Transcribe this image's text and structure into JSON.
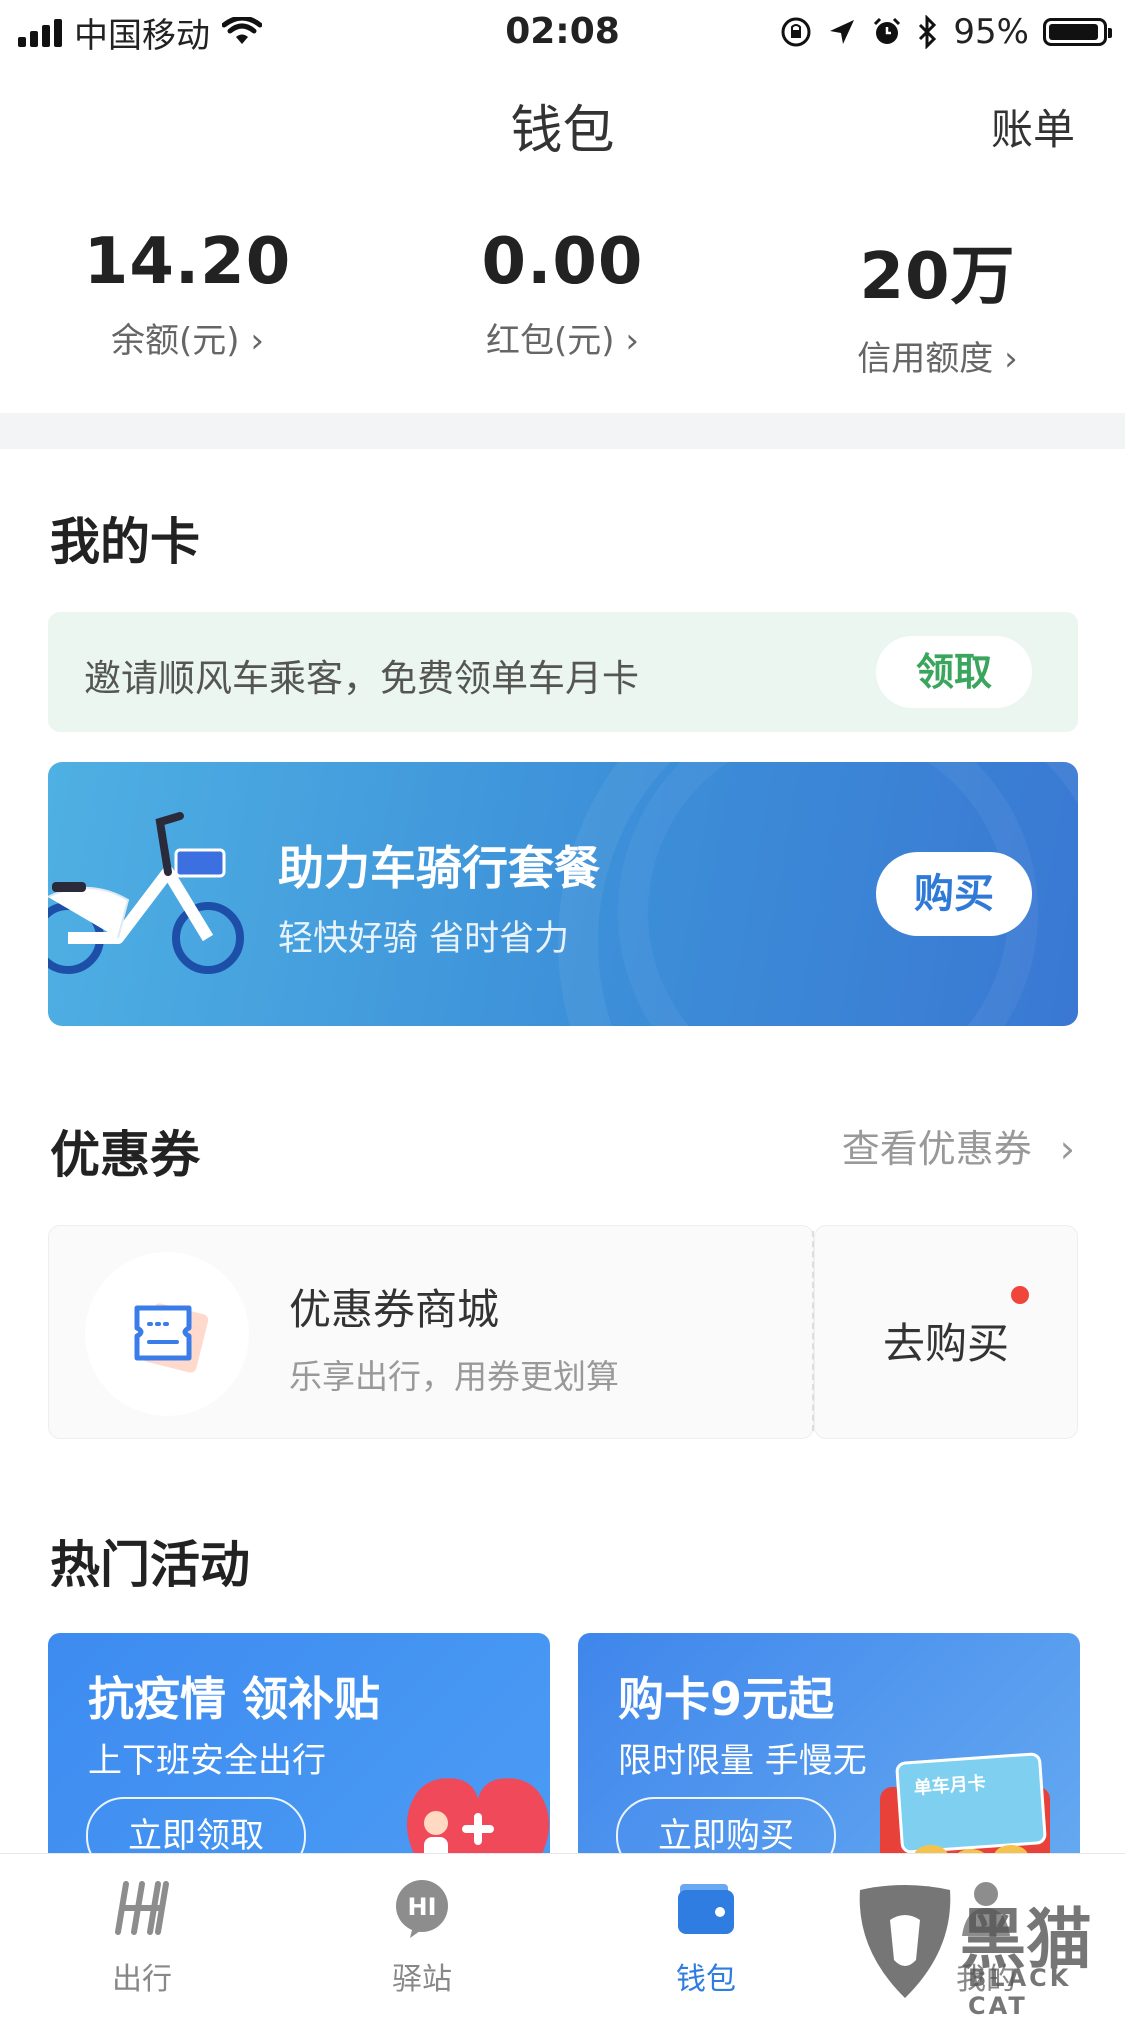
{
  "status_bar": {
    "carrier": "中国移动",
    "time": "02:08",
    "battery": "95%",
    "battery_level": 0.95
  },
  "nav": {
    "title": "钱包",
    "right": "账单"
  },
  "balances": [
    {
      "value": "14.20",
      "label": "余额(元)",
      "arrow": "›"
    },
    {
      "value": "0.00",
      "label": "红包(元)",
      "arrow": "›"
    },
    {
      "value": "20万",
      "label": "信用额度",
      "arrow": "›"
    }
  ],
  "my_cards": {
    "title": "我的卡",
    "invite": {
      "text": "邀请顺风车乘客，免费领单车月卡",
      "button": "领取"
    },
    "ebike": {
      "title": "助力车骑行套餐",
      "subtitle": "轻快好骑 省时省力",
      "button": "购买"
    }
  },
  "coupons": {
    "title": "优惠券",
    "link": "查看优惠券",
    "link_arrow": "›",
    "card": {
      "title": "优惠券商城",
      "subtitle": "乐享出行，用券更划算",
      "button": "去购买"
    }
  },
  "hot": {
    "title": "热门活动",
    "promos": [
      {
        "title": "抗疫情 领补贴",
        "subtitle": "上下班安全出行",
        "button": "立即领取"
      },
      {
        "title": "购卡9元起",
        "subtitle": "限时限量 手慢无",
        "button": "立即购买",
        "card_label": "单车月卡"
      }
    ]
  },
  "tabs": [
    {
      "label": "出行",
      "icon": "hellobike-logo-icon"
    },
    {
      "label": "驿站",
      "icon": "hi-bubble-icon"
    },
    {
      "label": "钱包",
      "icon": "wallet-icon",
      "active": true
    },
    {
      "label": "我的",
      "icon": "person-icon"
    }
  ],
  "watermark": {
    "cn": "黑猫",
    "en": "BLACK CAT"
  },
  "colors": {
    "accent": "#2f7de1",
    "green": "#3aa55c",
    "red_dot": "#f0453a"
  }
}
